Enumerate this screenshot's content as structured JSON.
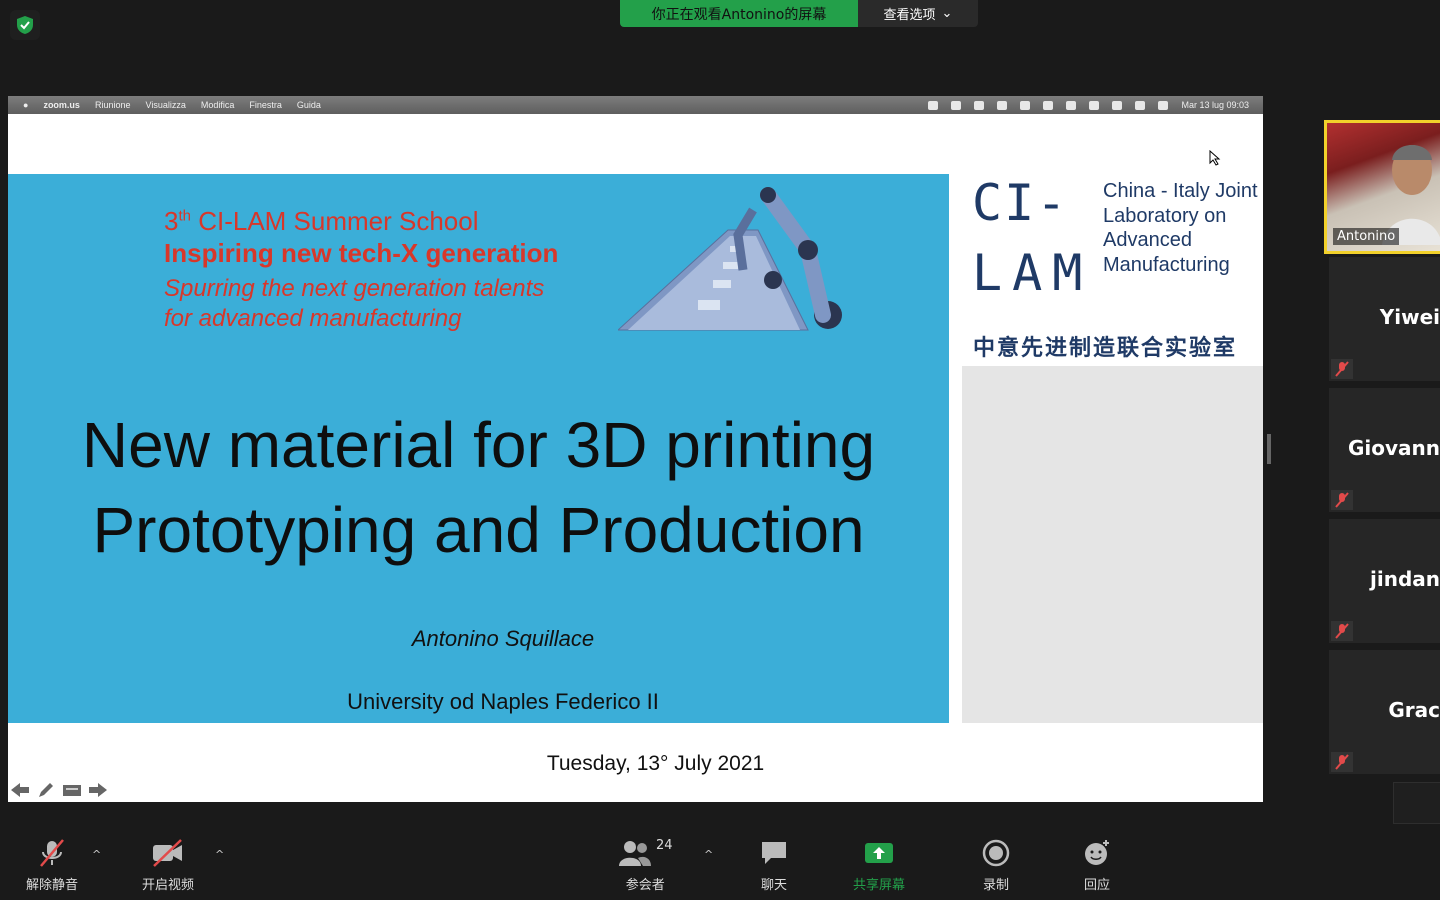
{
  "banner": {
    "viewing_text": "你正在观看Antonino的屏幕",
    "view_options": "查看选项"
  },
  "mac_menubar": {
    "items": [
      "zoom.us",
      "Riunione",
      "Visualizza",
      "Modifica",
      "Finestra",
      "Guida"
    ],
    "clock": "Mar 13 lug  09:03"
  },
  "slide": {
    "school_ordinal": "3",
    "school_ordinal_suffix": "th",
    "school_name": " CI-LAM Summer School",
    "motto": "Inspiring new tech-X generation",
    "subtitle_line1": "Spurring the next generation talents",
    "subtitle_line2": "for advanced manufacturing",
    "title_line1": "New material for 3D printing",
    "title_line2": "Prototyping and Production",
    "author": "Antonino Squillace",
    "university": "University od Naples Federico II",
    "date": "Tuesday, 13° July 2021",
    "logo_line1": "CI-",
    "logo_line2": "LAM",
    "logo_text": "China - Italy Joint Laboratory on Advanced Manufacturing",
    "logo_chinese": "中意先进制造联合实验室"
  },
  "participants": {
    "video_name": "Antonino",
    "list": [
      {
        "name": "Yiwei"
      },
      {
        "name": "Giovann"
      },
      {
        "name": "jindan"
      },
      {
        "name": "Grac"
      }
    ]
  },
  "toolbar": {
    "unmute": "解除静音",
    "start_video": "开启视频",
    "participants": "参会者",
    "participants_count": "24",
    "chat": "聊天",
    "share_screen": "共享屏幕",
    "record": "录制",
    "reactions": "回应"
  },
  "colors": {
    "accent_green": "#23a04a",
    "slide_blue": "#3baed8",
    "slide_red": "#d8372a",
    "logo_navy": "#1f3a66",
    "highlight_yellow": "#f2d12b"
  }
}
